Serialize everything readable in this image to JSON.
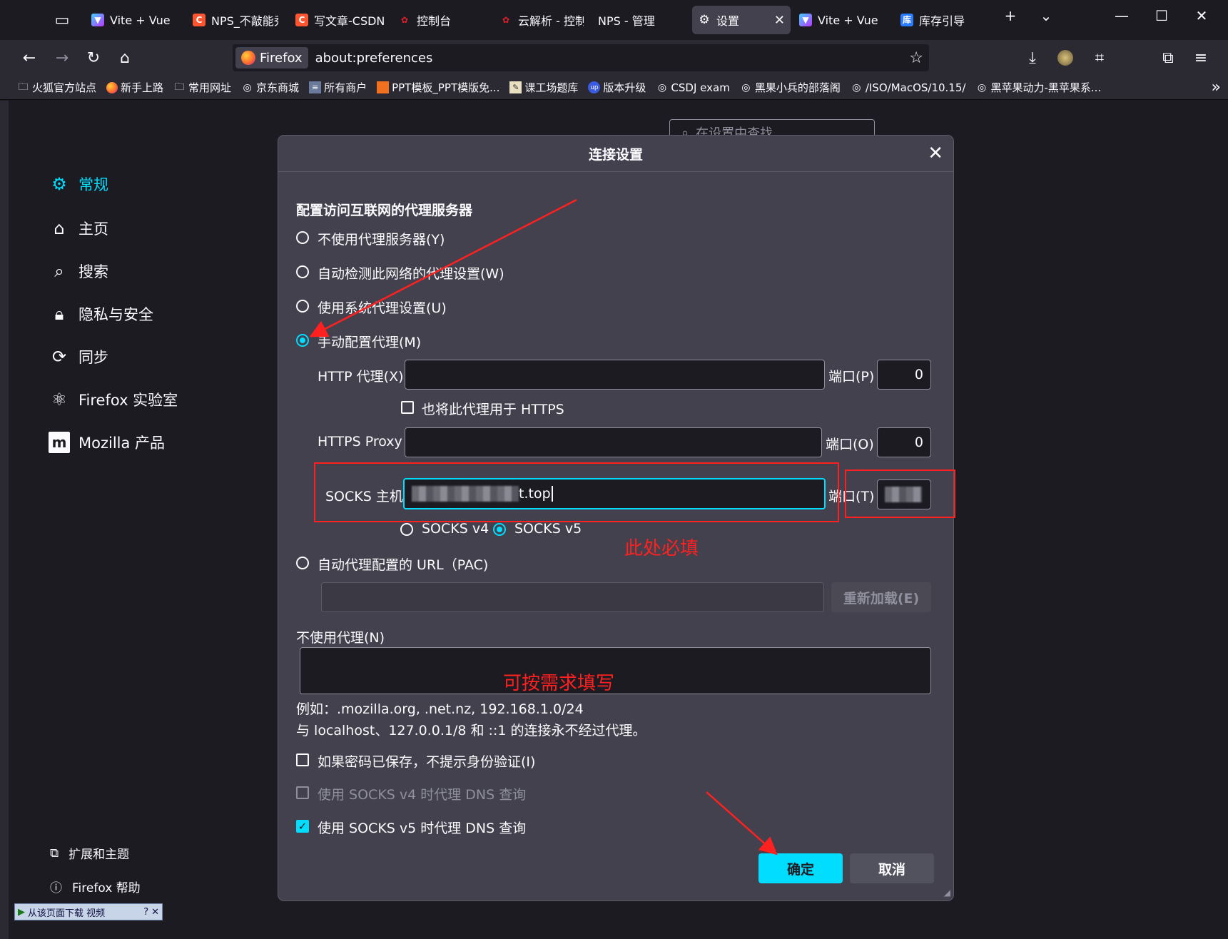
{
  "tabs": [
    {
      "label": "Vite + Vue",
      "icon": "vite-icon"
    },
    {
      "label": "NPS_不敲能秀",
      "icon": "csdn-icon"
    },
    {
      "label": "写文章-CSDN",
      "icon": "csdn-icon"
    },
    {
      "label": "控制台",
      "icon": "huawei-icon"
    },
    {
      "label": "云解析 - 控制",
      "icon": "huawei-icon"
    },
    {
      "label": "NPS - 管理",
      "icon": ""
    },
    {
      "label": "设置",
      "icon": "gear-icon",
      "active": true
    },
    {
      "label": "Vite + Vue",
      "icon": "vite-icon"
    },
    {
      "label": "库存引导",
      "icon": "app-icon"
    }
  ],
  "urlbar": {
    "identity": "Firefox",
    "url": "about:preferences"
  },
  "bookmarks": [
    "火狐官方站点",
    "新手上路",
    "常用网址",
    "京东商城",
    "所有商户",
    "PPT模板_PPT模版免...",
    "课工场题库",
    "版本升级",
    "CSDJ exam",
    "黑果小兵的部落阁",
    "/ISO/MacOS/10.15/",
    "黑苹果动力-黑苹果系..."
  ],
  "sidebar": {
    "items": [
      {
        "label": "常规",
        "icon": "gear-icon",
        "selected": true
      },
      {
        "label": "主页",
        "icon": "home-icon"
      },
      {
        "label": "搜索",
        "icon": "search-icon"
      },
      {
        "label": "隐私与安全",
        "icon": "lock-icon"
      },
      {
        "label": "同步",
        "icon": "sync-icon"
      },
      {
        "label": "Firefox 实验室",
        "icon": "labs-icon"
      },
      {
        "label": "Mozilla 产品",
        "icon": "mozilla-icon"
      }
    ],
    "extensions": "扩展和主题",
    "help": "Firefox 帮助"
  },
  "search": {
    "placeholder": "在设置中查找"
  },
  "dialog": {
    "title": "连接设置",
    "heading": "配置访问互联网的代理服务器",
    "radio_none": "不使用代理服务器(Y)",
    "radio_autodetect": "自动检测此网络的代理设置(W)",
    "radio_system": "使用系统代理设置(U)",
    "radio_manual": "手动配置代理(M)",
    "http_label": "HTTP 代理(X)",
    "http_port_label": "端口(P)",
    "http_port": "0",
    "also_https": "也将此代理用于 HTTPS",
    "https_label": "HTTPS Proxy",
    "https_port_label": "端口(O)",
    "https_port": "0",
    "socks_label": "SOCKS 主机",
    "socks_host_suffix": "t.top",
    "socks_port_label": "端口(T)",
    "socks_v4": "SOCKS v4",
    "socks_v5": "SOCKS v5",
    "pac_label": "自动代理配置的 URL（PAC)",
    "reload_button": "重新加载(E)",
    "no_proxy_label": "不使用代理(N)",
    "example": "例如：.mozilla.org, .net.nz, 192.168.1.0/24",
    "localhost_note": "与 localhost、127.0.0.1/8 和 ::1 的连接永不经过代理。",
    "no_auth_prompt": "如果密码已保存，不提示身份验证(I)",
    "dns_v4": "使用 SOCKS v4 时代理 DNS 查询",
    "dns_v5": "使用 SOCKS v5 时代理 DNS 查询",
    "ok": "确定",
    "cancel": "取消"
  },
  "annotations": {
    "required": "此处必填",
    "optional": "可按需求填写"
  },
  "downloader": "从该页面下载 视频",
  "colors": {
    "accent": "#00ddff",
    "annotation": "#ff2020",
    "dialog_bg": "#42414d",
    "page_bg": "#1c1b22"
  }
}
